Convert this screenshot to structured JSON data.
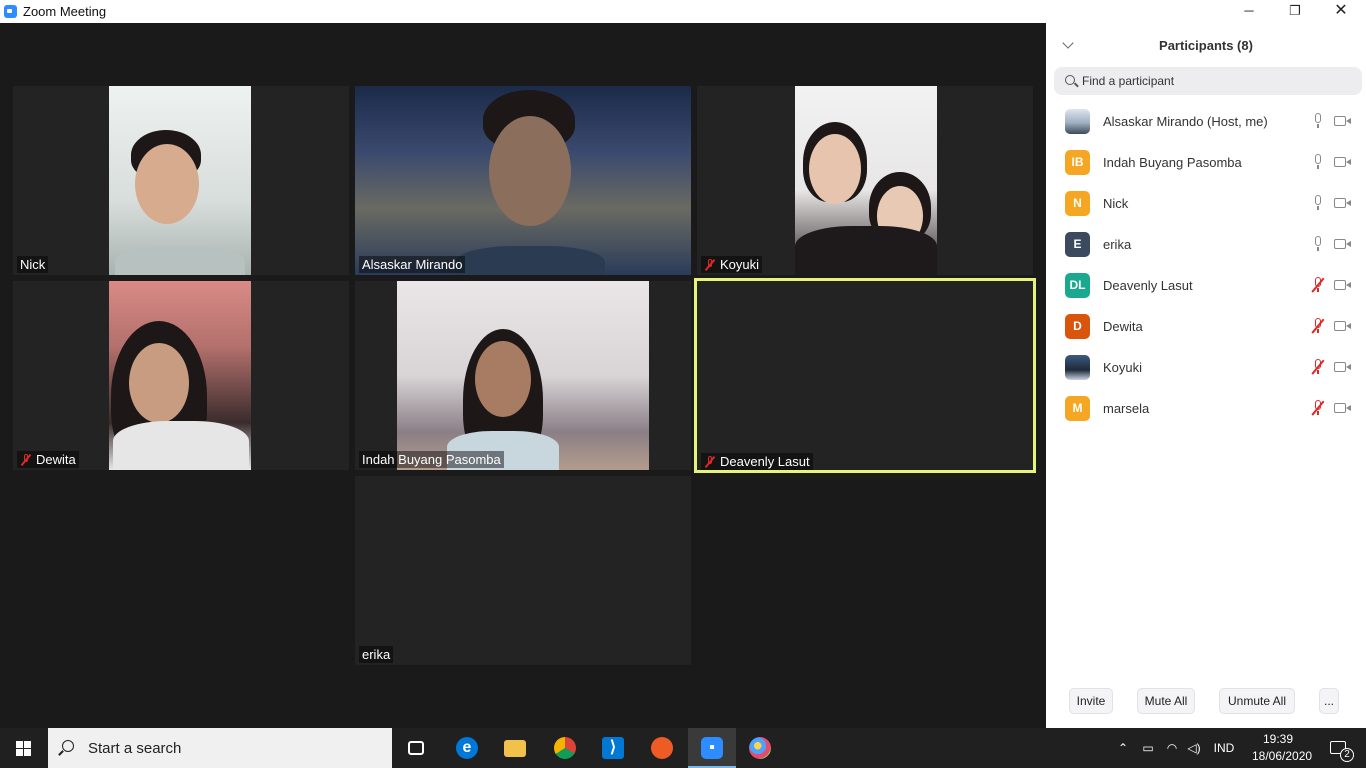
{
  "window": {
    "title": "Zoom Meeting",
    "minimize": "─",
    "maximize": "❐",
    "close": "✕"
  },
  "tiles": [
    {
      "name": "Nick",
      "muted": false
    },
    {
      "name": "Alsaskar Mirando",
      "muted": false
    },
    {
      "name": "Koyuki",
      "muted": true
    },
    {
      "name": "Dewita",
      "muted": true
    },
    {
      "name": "Indah Buyang Pasomba",
      "muted": false
    },
    {
      "name": "Deavenly Lasut",
      "muted": true,
      "active_speaker": true
    },
    {
      "name": "erika",
      "muted": false,
      "video_off": true
    }
  ],
  "participants_panel": {
    "title": "Participants (8)",
    "search_placeholder": "Find a participant",
    "participants": [
      {
        "name": "Alsaskar Mirando (Host, me)",
        "initials": "",
        "avatar": "photo",
        "mic": "on"
      },
      {
        "name": "Indah Buyang Pasomba",
        "initials": "IB",
        "color": "#f5a623",
        "mic": "on"
      },
      {
        "name": "Nick",
        "initials": "N",
        "color": "#f5a623",
        "mic": "on"
      },
      {
        "name": "erika",
        "initials": "E",
        "color": "#3b4a5e",
        "mic": "on"
      },
      {
        "name": "Deavenly Lasut",
        "initials": "DL",
        "color": "#1aa88f",
        "mic": "muted"
      },
      {
        "name": "Dewita",
        "initials": "D",
        "color": "#d9540c",
        "mic": "muted"
      },
      {
        "name": "Koyuki",
        "initials": "",
        "avatar": "photo",
        "mic": "muted"
      },
      {
        "name": "marsela",
        "initials": "M",
        "color": "#f5a623",
        "mic": "muted"
      }
    ],
    "buttons": {
      "invite": "Invite",
      "mute_all": "Mute All",
      "unmute_all": "Unmute All",
      "more": "..."
    }
  },
  "taskbar": {
    "search_text": "Start a search",
    "apps": [
      "task-view",
      "edge",
      "file-explorer",
      "chrome",
      "vscode",
      "postman",
      "zoom",
      "paint"
    ],
    "language": "IND",
    "time": "19:39",
    "date": "18/06/2020",
    "notification_count": "2"
  }
}
